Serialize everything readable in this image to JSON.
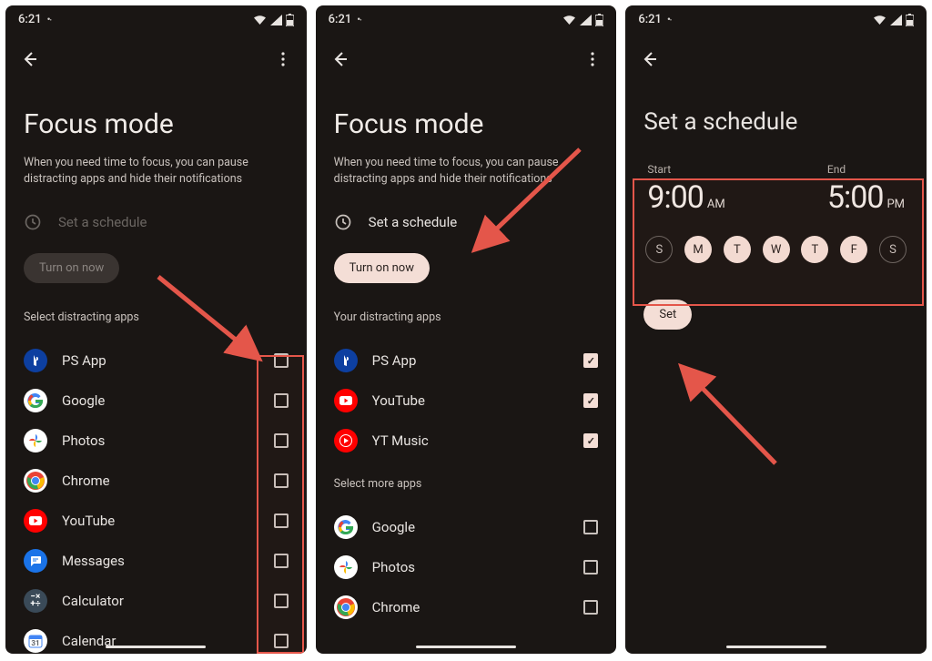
{
  "status": {
    "time": "6:21",
    "wifi": true,
    "signal": true,
    "battery": true
  },
  "screen1": {
    "title": "Focus mode",
    "subtitle": "When you need time to focus, you can pause distracting apps and hide their notifications",
    "schedule_label": "Set a schedule",
    "turn_on_label": "Turn on now",
    "section": "Select distracting apps",
    "apps": [
      {
        "name": "PS App",
        "icon": "ps",
        "checked": false
      },
      {
        "name": "Google",
        "icon": "google",
        "checked": false
      },
      {
        "name": "Photos",
        "icon": "photos",
        "checked": false
      },
      {
        "name": "Chrome",
        "icon": "chrome",
        "checked": false
      },
      {
        "name": "YouTube",
        "icon": "youtube",
        "checked": false
      },
      {
        "name": "Messages",
        "icon": "messages",
        "checked": false
      },
      {
        "name": "Calculator",
        "icon": "calculator",
        "checked": false
      },
      {
        "name": "Calendar",
        "icon": "calendar",
        "checked": false
      }
    ]
  },
  "screen2": {
    "title": "Focus mode",
    "subtitle": "When you need time to focus, you can pause distracting apps and hide their notifications",
    "schedule_label": "Set a schedule",
    "turn_on_label": "Turn on now",
    "section_your": "Your distracting apps",
    "section_more": "Select more apps",
    "your_apps": [
      {
        "name": "PS App",
        "icon": "ps",
        "checked": true
      },
      {
        "name": "YouTube",
        "icon": "youtube",
        "checked": true
      },
      {
        "name": "YT Music",
        "icon": "ytmusic",
        "checked": true
      }
    ],
    "more_apps": [
      {
        "name": "Google",
        "icon": "google",
        "checked": false
      },
      {
        "name": "Photos",
        "icon": "photos",
        "checked": false
      },
      {
        "name": "Chrome",
        "icon": "chrome",
        "checked": false
      }
    ]
  },
  "screen3": {
    "title": "Set a schedule",
    "start_label": "Start",
    "end_label": "End",
    "start_time": "9:00",
    "start_ampm": "AM",
    "end_time": "5:00",
    "end_ampm": "PM",
    "days": [
      {
        "letter": "S",
        "on": false
      },
      {
        "letter": "M",
        "on": true
      },
      {
        "letter": "T",
        "on": true
      },
      {
        "letter": "W",
        "on": true
      },
      {
        "letter": "T",
        "on": true
      },
      {
        "letter": "F",
        "on": true
      },
      {
        "letter": "S",
        "on": false
      }
    ],
    "set_label": "Set"
  }
}
